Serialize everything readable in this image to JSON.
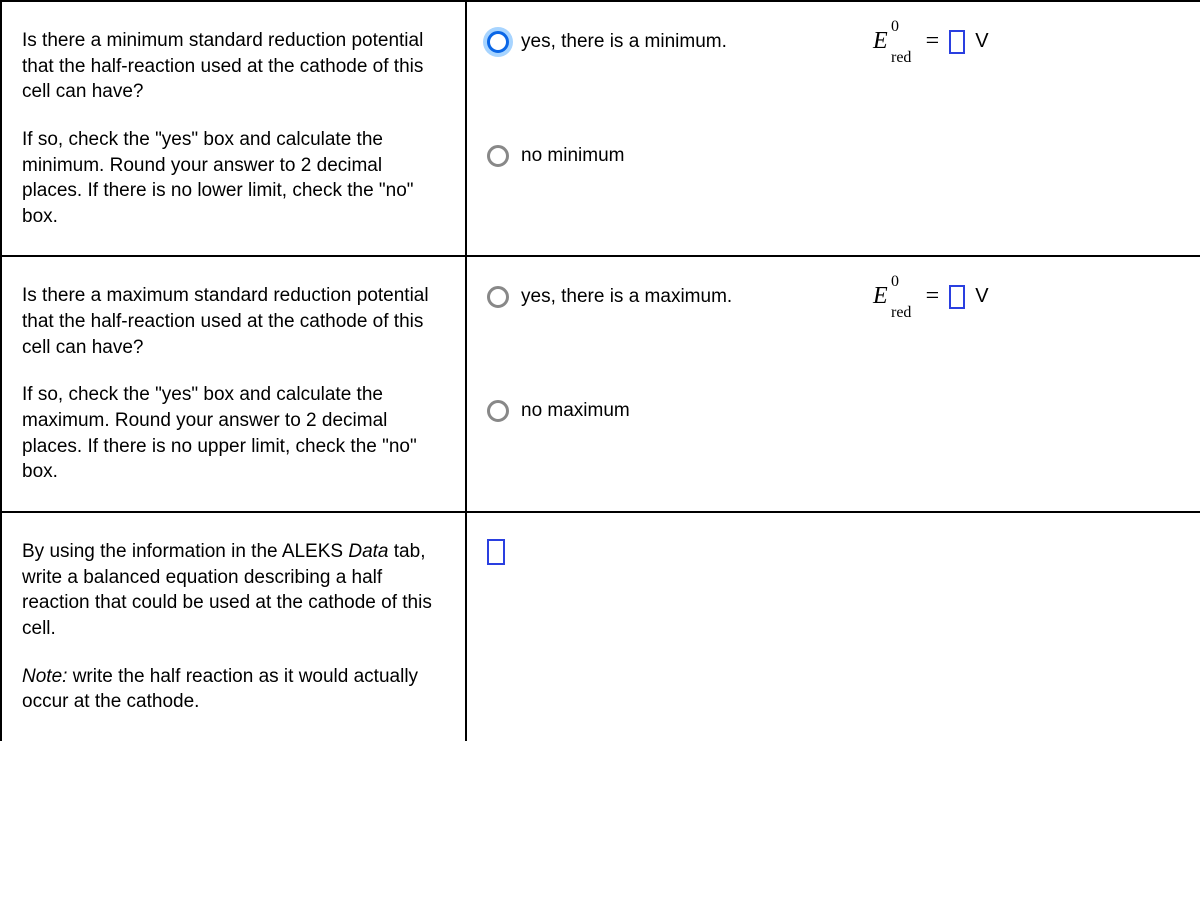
{
  "rows": [
    {
      "prompt1": "Is there a minimum standard reduction potential that the half-reaction used at the cathode of this cell can have?",
      "prompt2": "If so, check the \"yes\" box and calculate the minimum. Round your answer to 2 decimal places. If there is no lower limit, check the \"no\" box.",
      "yesLabel": "yes, there is a minimum.",
      "noLabel": "no minimum",
      "evar": "E",
      "sup": "0",
      "sub": "red",
      "equals": "=",
      "unit": "V",
      "yesSelected": true
    },
    {
      "prompt1": "Is there a maximum standard reduction potential that the half-reaction used at the cathode of this cell can have?",
      "prompt2": "If so, check the \"yes\" box and calculate the maximum. Round your answer to 2 decimal places. If there is no upper limit, check the \"no\" box.",
      "yesLabel": "yes, there is a maximum.",
      "noLabel": "no maximum",
      "evar": "E",
      "sup": "0",
      "sub": "red",
      "equals": "=",
      "unit": "V",
      "yesSelected": false
    }
  ],
  "row3": {
    "line1a": "By using the information in the ALEKS ",
    "line1b": "Data",
    "line1c": " tab, write a balanced equation describing a half reaction that could be used at the cathode of this cell.",
    "noteLabel": "Note:",
    "noteText": " write the half reaction as it would actually occur at the cathode."
  }
}
